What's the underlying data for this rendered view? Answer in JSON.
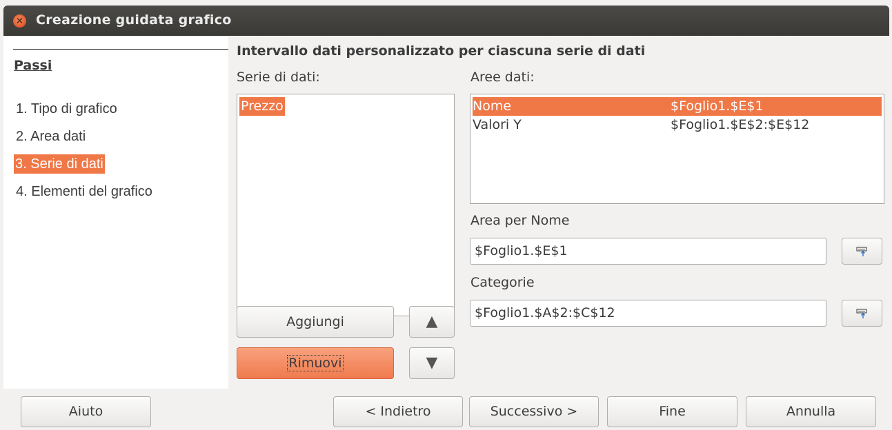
{
  "window": {
    "title": "Creazione guidata grafico"
  },
  "steps": {
    "heading": "Passi",
    "items": [
      {
        "label": "1. Tipo di grafico"
      },
      {
        "label": "2. Area dati"
      },
      {
        "label": "3. Serie di dati"
      },
      {
        "label": "4. Elementi del grafico"
      }
    ]
  },
  "main": {
    "heading": "Intervallo dati personalizzato per ciascuna serie di dati",
    "series_label": "Serie di dati:",
    "series": [
      "Prezzo"
    ],
    "ranges_label": "Aree dati:",
    "ranges": [
      {
        "name": "Nome",
        "range": "$Foglio1.$E$1"
      },
      {
        "name": "Valori Y",
        "range": "$Foglio1.$E$2:$E$12"
      }
    ],
    "name_range_label": "Area per Nome",
    "name_range_value": "$Foglio1.$E$1",
    "categories_label": "Categorie",
    "categories_value": "$Foglio1.$A$2:$C$12",
    "add_button": "Aggiungi",
    "remove_button": "Rimuovi",
    "up_arrow": "▲",
    "down_arrow": "▼"
  },
  "footer": {
    "help": "Aiuto",
    "back": "< Indietro",
    "next": "Successivo >",
    "finish": "Fine",
    "cancel": "Annulla"
  },
  "colors": {
    "accent": "#f07746",
    "titlebar": "#3f3e3a"
  }
}
